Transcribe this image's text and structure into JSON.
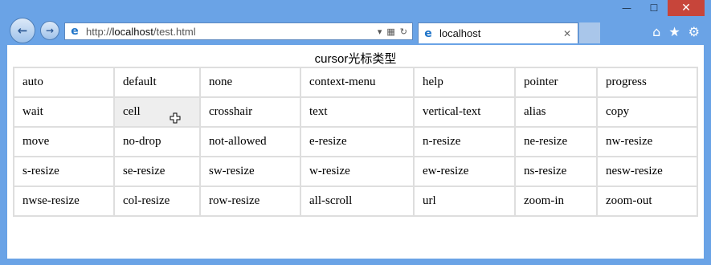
{
  "browser": {
    "url_prefix": "http://",
    "url_host": "localhost",
    "url_path": "/test.html",
    "tab_title": "localhost",
    "close_label": "✕",
    "minimize_label": "—",
    "maximize_label": "☐",
    "tab_close_label": "✕",
    "back_icon": "←",
    "forward_icon": "→",
    "home_icon": "⌂",
    "favorites_icon": "★",
    "settings_icon": "⚙"
  },
  "page": {
    "caption": "cursor光标类型"
  },
  "table": {
    "rows": [
      [
        "auto",
        "default",
        "none",
        "context-menu",
        "help",
        "pointer",
        "progress"
      ],
      [
        "wait",
        "cell",
        "crosshair",
        "text",
        "vertical-text",
        "alias",
        "copy"
      ],
      [
        "move",
        "no-drop",
        "not-allowed",
        "e-resize",
        "n-resize",
        "ne-resize",
        "nw-resize"
      ],
      [
        "s-resize",
        "se-resize",
        "sw-resize",
        "w-resize",
        "ew-resize",
        "ns-resize",
        "nesw-resize"
      ],
      [
        "nwse-resize",
        "col-resize",
        "row-resize",
        "all-scroll",
        "url",
        "zoom-in",
        "zoom-out"
      ]
    ]
  }
}
